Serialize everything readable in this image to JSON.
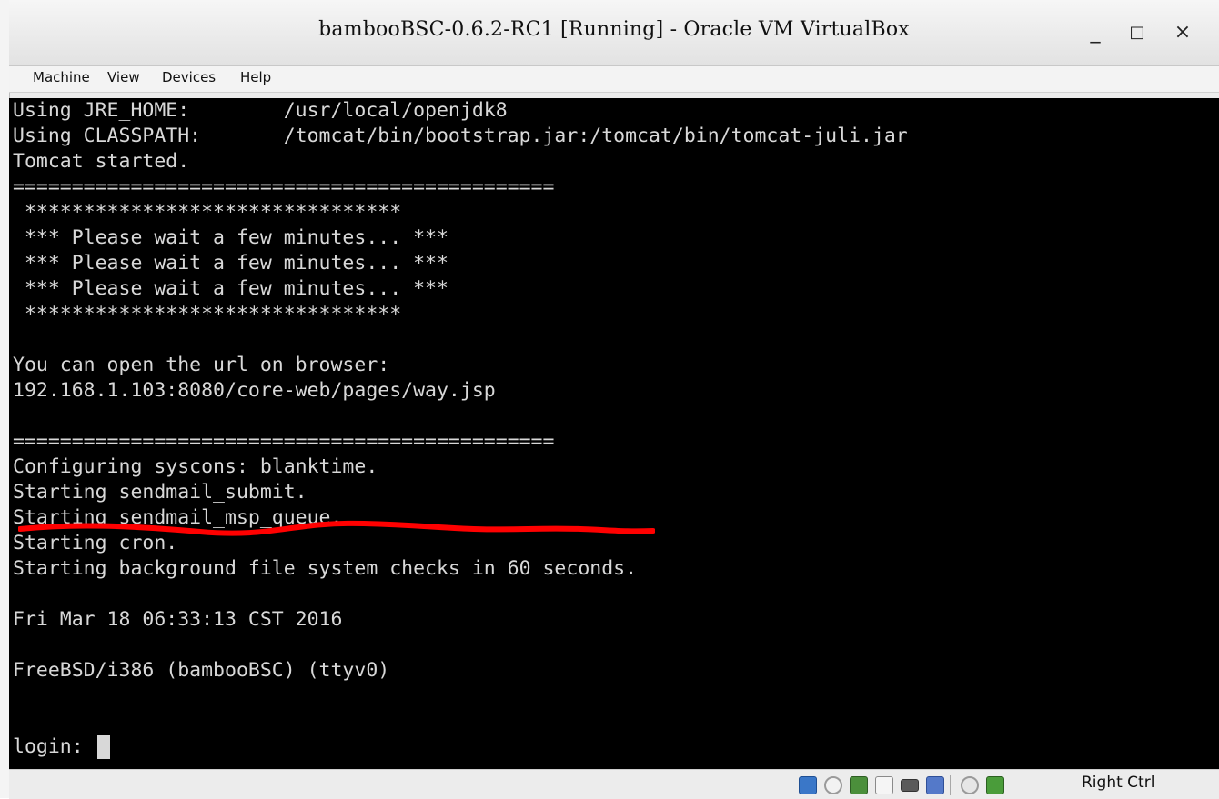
{
  "window": {
    "title": "bambooBSC-0.6.2-RC1 [Running] - Oracle VM VirtualBox",
    "controls": {
      "minimize": "_",
      "maximize": "□",
      "close": "×"
    }
  },
  "menu": [
    "Machine",
    "View",
    "Devices",
    "Help"
  ],
  "terminal": {
    "lines": [
      "Using JRE_HOME:        /usr/local/openjdk8",
      "Using CLASSPATH:       /tomcat/bin/bootstrap.jar:/tomcat/bin/tomcat-juli.jar",
      "Tomcat started.",
      "==============================================",
      " ********************************",
      " *** Please wait a few minutes... ***",
      " *** Please wait a few minutes... ***",
      " *** Please wait a few minutes... ***",
      " ********************************",
      "",
      "You can open the url on browser:",
      "192.168.1.103:8080/core-web/pages/way.jsp",
      "",
      "==============================================",
      "Configuring syscons: blanktime.",
      "Starting sendmail_submit.",
      "Starting sendmail_msp_queue.",
      "Starting cron.",
      "Starting background file system checks in 60 seconds.",
      "",
      "Fri Mar 18 06:33:13 CST 2016",
      "",
      "FreeBSD/i386 (bambooBSC) (ttyv0)",
      "",
      "login: "
    ],
    "annotation_color": "#ff0000"
  },
  "statusbar": {
    "icons": [
      "network-status-icon",
      "optical-drive-icon",
      "network-adapter-icon",
      "shared-folder-icon",
      "usb-icon",
      "cpu-vt-icon",
      "mouse-integration-icon",
      "keyboard-capture-icon"
    ],
    "host_key": "Right Ctrl"
  }
}
